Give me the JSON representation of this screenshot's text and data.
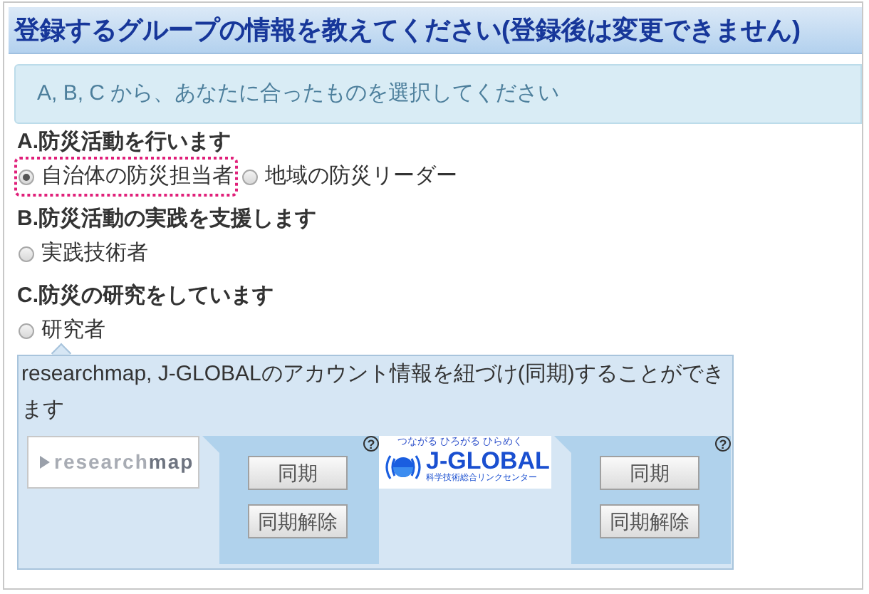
{
  "header": {
    "title": "登録するグループの情報を教えてください(登録後は変更できません)"
  },
  "notice": "A, B, C から、あなたに合ったものを選択してください",
  "groups": [
    {
      "heading": "A.防災活動を行います",
      "options": [
        {
          "label": "自治体の防災担当者",
          "selected": true,
          "focused": true
        },
        {
          "label": "地域の防災リーダー",
          "selected": false,
          "focused": false
        }
      ]
    },
    {
      "heading": "B.防災活動の実践を支援します",
      "options": [
        {
          "label": "実践技術者",
          "selected": false,
          "focused": false
        }
      ]
    },
    {
      "heading": "C.防災の研究をしています",
      "options": [
        {
          "label": "研究者",
          "selected": false,
          "focused": false
        }
      ]
    }
  ],
  "link_panel": {
    "text": "researchmap, J-GLOBALのアカウント情報を紐づけ(同期)することができます",
    "services": [
      {
        "kind": "researchmap",
        "logo": {
          "name": "research**map**"
        },
        "help": "?",
        "buttons": [
          "同期",
          "同期解除"
        ]
      },
      {
        "kind": "jglobal",
        "logo": {
          "tagline": "つながる ひろがる ひらめく",
          "name": "J-GLOBAL",
          "subtitle": "科学技術総合リンクセンター"
        },
        "help": "?",
        "buttons": [
          "同期",
          "同期解除"
        ]
      }
    ]
  }
}
